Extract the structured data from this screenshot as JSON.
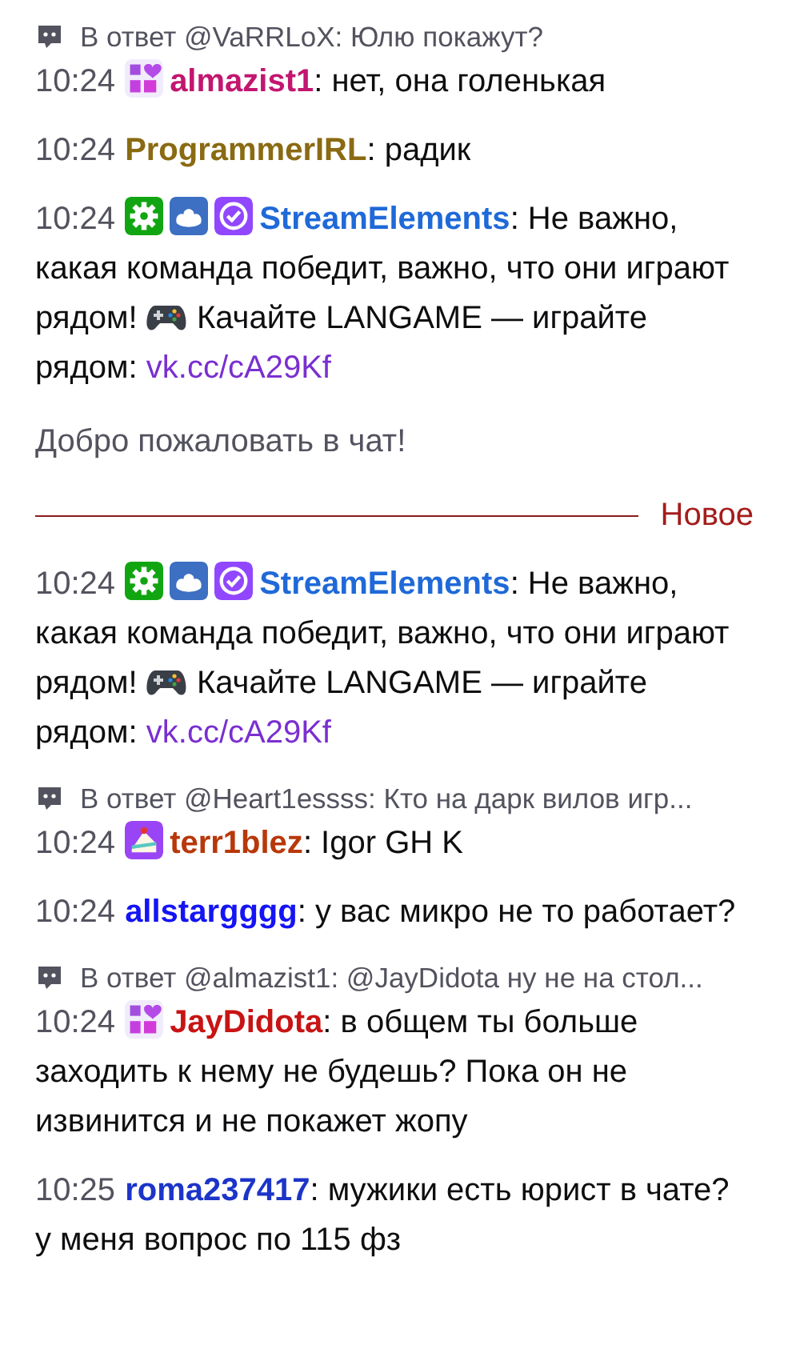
{
  "messages": [
    {
      "kind": "chat",
      "reply": "В ответ @VaRRLoX: Юлю покажут?",
      "time": "10:24",
      "badges": [
        {
          "kind": "year"
        }
      ],
      "user": "almazist1",
      "color": "#c2166f",
      "parts": [
        {
          "kind": "text",
          "text": ": нет, она голенькая"
        }
      ]
    },
    {
      "kind": "chat",
      "time": "10:24",
      "user": "ProgrammerIRL",
      "color": "#8a6a12",
      "parts": [
        {
          "kind": "text",
          "text": ": радик"
        }
      ]
    },
    {
      "kind": "chat",
      "time": "10:24",
      "badges": [
        {
          "kind": "gear"
        },
        {
          "kind": "cloud"
        },
        {
          "kind": "verified"
        }
      ],
      "user": "StreamElements",
      "color": "#1f69d8",
      "parts": [
        {
          "kind": "text",
          "text": ": Не важно, какая команда победит, важно, что они играют рядом! "
        },
        {
          "kind": "emote"
        },
        {
          "kind": "text",
          "text": " Качайте LANGAME — играйте рядом: "
        },
        {
          "kind": "link",
          "text": "vk.cc/cA29Kf"
        }
      ]
    },
    {
      "kind": "notice",
      "text": "Добро пожаловать в чат!"
    },
    {
      "kind": "divider",
      "text": "Новое"
    },
    {
      "kind": "chat",
      "time": "10:24",
      "badges": [
        {
          "kind": "gear"
        },
        {
          "kind": "cloud"
        },
        {
          "kind": "verified"
        }
      ],
      "user": "StreamElements",
      "color": "#1f69d8",
      "parts": [
        {
          "kind": "text",
          "text": ": Не важно, какая команда победит, важно, что они играют рядом! "
        },
        {
          "kind": "emote"
        },
        {
          "kind": "text",
          "text": " Качайте LANGAME — играйте рядом: "
        },
        {
          "kind": "link",
          "text": "vk.cc/cA29Kf"
        }
      ]
    },
    {
      "kind": "chat",
      "reply": "В ответ @Heart1essss: Кто на дарк вилов игр...",
      "time": "10:24",
      "badges": [
        {
          "kind": "cake"
        }
      ],
      "user": "terr1blez",
      "color": "#b8380a",
      "parts": [
        {
          "kind": "text",
          "text": ": Igor GH K"
        }
      ]
    },
    {
      "kind": "chat",
      "time": "10:24",
      "user": "allstargggg",
      "color": "#1414f5",
      "parts": [
        {
          "kind": "text",
          "text": ": у вас микро не то работает?"
        }
      ]
    },
    {
      "kind": "chat",
      "reply": "В ответ @almazist1: @JayDidota ну не на стол...",
      "time": "10:24",
      "badges": [
        {
          "kind": "year"
        }
      ],
      "user": "JayDidota",
      "color": "#c81414",
      "parts": [
        {
          "kind": "text",
          "text": ": в общем ты больше заходить к нему не будешь? Пока он не извинится и не покажет жопу"
        }
      ]
    },
    {
      "kind": "chat",
      "time": "10:25",
      "user": "roma237417",
      "color": "#1c35c8",
      "parts": [
        {
          "kind": "text",
          "text": ": мужики есть юрист в чате? у меня вопрос по 115 фз"
        }
      ]
    }
  ]
}
